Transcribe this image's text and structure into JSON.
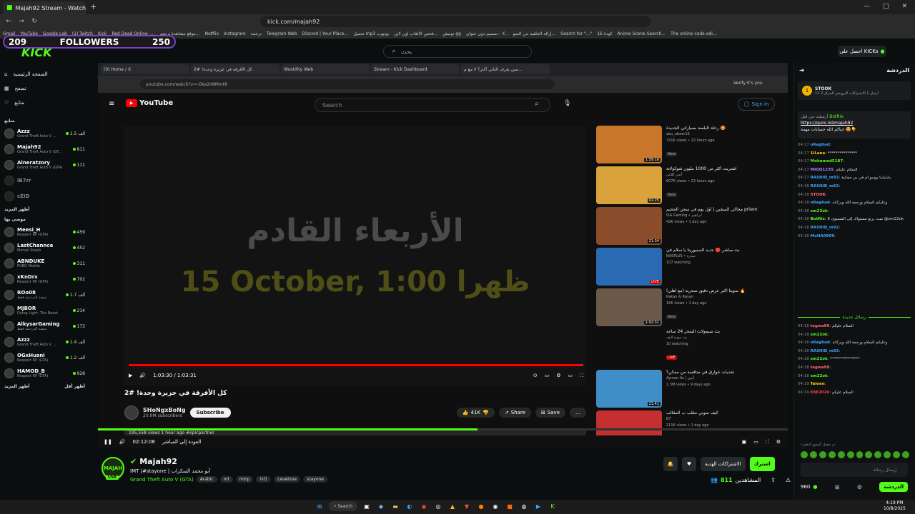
{
  "browser": {
    "tab_title": "Majah92 Stream - Watch Liv",
    "url": "kick.com/majah92",
    "bookmarks": [
      "Gmail",
      "YouTube",
      "Google Lab",
      "(1) Twitch",
      "Kick",
      "Red Dead Online -...",
      "موقع مشاهدة و تحم...",
      "Netflix",
      "Instagram",
      "ترجمة",
      "Telegram Web",
      "Discord | Your Place...",
      "تحميل mp3 يوتيوب",
      "فحص الالعاب اون لاين...",
      "توتيش gg",
      "تصميم دون عنوان - Y...",
      "إزالة الخلفية من الصو...",
      "Search for \"...\"",
      "كودة 16",
      "Anime Scene Search...",
      "The online code edi..."
    ]
  },
  "overlay": {
    "followers_left": "209",
    "followers_label": "FOLLOWERS",
    "followers_right": "250"
  },
  "kick": {
    "logo": "KICK",
    "search_placeholder": "بحث",
    "get_kicks": "احصل على KICKs",
    "nav": [
      "الصفحة الرئيسية",
      "تصفح",
      "متابع"
    ],
    "following_head": "متابع",
    "following": [
      {
        "name": "Azzz",
        "game": "Grand Theft Auto V ...",
        "viewers": "1.5 ألف"
      },
      {
        "name": "Majah92",
        "game": "Grand Theft Auto V (GT...",
        "viewers": "811"
      },
      {
        "name": "Alneratzory",
        "game": "Grand Theft Auto V (GTA)",
        "viewers": "111"
      },
      {
        "name": "lB7rr",
        "game": "",
        "viewers": ""
      },
      {
        "name": "cEID",
        "game": "",
        "viewers": ""
      }
    ],
    "show_more_1": "أظهر المزيد",
    "recommended_head": "موصى بها",
    "recommended": [
      {
        "name": "Meesi_H",
        "game": "Respect RP (GTA)",
        "viewers": "459"
      },
      {
        "name": "LastChannce",
        "game": "Marvel Rivals",
        "viewers": "452"
      },
      {
        "name": "ABNDUKE",
        "game": "PUBG Mobile",
        "viewers": "311"
      },
      {
        "name": "xKnDrx",
        "game": "Respect RP (GTA)",
        "viewers": "702"
      },
      {
        "name": "ROo08",
        "game": "منصة الدردشة فقط",
        "viewers": "1.7 ألف"
      },
      {
        "name": "MJBOR",
        "game": "Dying Light: The Beast",
        "viewers": "214"
      },
      {
        "name": "AlkysarGaming",
        "game": "منصة الدردشة فقط",
        "viewers": "173"
      },
      {
        "name": "Azzz",
        "game": "Grand Theft Auto V ...",
        "viewers": "1.4 ألف"
      },
      {
        "name": "OGxHusni",
        "game": "Respect RP (GTA)",
        "viewers": "1.2 ألف"
      },
      {
        "name": "HAMOD_B",
        "game": "Respect RP (GTA)",
        "viewers": "928"
      }
    ],
    "show_more_2": "أظهر المزيد",
    "show_less": "أظهر أقل"
  },
  "inner_browser": {
    "tabs": [
      "(9) Home / X",
      "كل الأفرقة في جزيرة وحدة! #2",
      "Wootility Web",
      "Stream - Kick Dashboard",
      "مين يعرف التاني أكثر؟ لا مع م..."
    ],
    "url": "youtube.com/watch?v=-Oke2IWMmt8",
    "verify": "Verify it's you"
  },
  "youtube": {
    "logo": "YouTube",
    "search_placeholder": "Search",
    "signin": "Sign in",
    "video_line1": "الأربعاء القادم",
    "video_line2": "15 October, 1:00 ظهرا",
    "time": "1:03:30 / 1:03:31",
    "progress_fraction": 0.997,
    "title": "كل الأفرقة في جزيرة وحدة! #2",
    "channel": "SHoNgxBoNg",
    "subs": "20.9M subscribers",
    "subscribe": "Subscribe",
    "likes": "41K",
    "share": "Share",
    "save": "Save",
    "desc": "195,558 views  1 hour ago  #epicpartner",
    "recs": [
      {
        "title": "رحلة البلسة بسياراتي الجديدة 🤩",
        "channel": "abu_abeer16",
        "meta": "741K views • 22 hours ago",
        "badge": "New",
        "dur": "1:59:16",
        "color": "#c9762b"
      },
      {
        "title": "اشتريت أكثر من 1000 مليون شوكولاتة",
        "channel": "أنس كلاش",
        "meta": "607K views • 23 hours ago",
        "badge": "New",
        "dur": "41:25",
        "color": "#d9a23a"
      },
      {
        "title": "محاكي السجين | أول يوم في سجن الجحيم prison",
        "channel": "iSA Gaming • ابراهيم",
        "meta": "42K views • 1 day ago",
        "badge": "",
        "dur": "21:34",
        "color": "#8a4c2a"
      },
      {
        "title": "بث مباشر 🔴 جديد السنيوريتا يا سلام في",
        "channel": "NASPLUS • سدرة",
        "meta": "107 watching",
        "badge": "",
        "dur": "LIVE",
        "color": "#2a6ab3"
      },
      {
        "title": "سويتا اكبر عرض دقيق سحرية (مع أهلي) 🔥",
        "channel": "Rakan & Rayan",
        "meta": "16K views • 1 day ago",
        "badge": "New",
        "dur": "1:02:31",
        "color": "#6b5a4a"
      },
      {
        "title": "بث سيمولات السحر 24 ساعة",
        "channel": "بث موزة لايف",
        "meta": "10 watching",
        "badge": "LIVE",
        "dur": "",
        "color": "#0f0f0f"
      },
      {
        "title": "تحديات خوارق في منافسة من ممكن؟",
        "channel": "Ayman Az | أيمن",
        "meta": "1.3M views • 9 days ago",
        "badge": "",
        "dur": "21:41",
        "color": "#3f8ec7"
      },
      {
        "title": "كيف صوبي مقلب ب المقالب",
        "channel": "B7",
        "meta": "211K views • 1 day ago",
        "badge": "",
        "dur": "",
        "color": "#c42f2f"
      }
    ]
  },
  "player": {
    "time": "02:12:06",
    "live_label": "العودة إلى المباشر",
    "progress_fraction": 0.55
  },
  "stream": {
    "avatar_text": "MAJAH",
    "live": "LIVE",
    "name": "Majah92",
    "title": "IMT |#stayone | أبو محمد السكراب",
    "game": "Grand Theft Auto V (GTA)",
    "tags": [
      "Arabic",
      "mt",
      "mtrp",
      "lvl1",
      "Levelone",
      "stayone"
    ],
    "subscribe": "اشترك",
    "gifts": "الاشتراكات الهدية",
    "viewers_label": "المشاهدين",
    "viewers": "811"
  },
  "chat": {
    "title": "الدردشة",
    "pinned_user": "STOOK",
    "pinned_text": "أرسل 1 الاشتراكات الترويجي المركز 2",
    "pinned_count": "11",
    "pin_by": "أرسلت من قبل",
    "pin_user": "BotRix",
    "pin_link": "https://guns.lol/majah92",
    "pin_text": "حياكم الله حسابات مهمة 🤩👇",
    "messages": [
      {
        "time": "04:17",
        "user": "oRaghad",
        "color": "#3ea6ff",
        "text": ""
      },
      {
        "time": "04:17",
        "user": "1lLana",
        "color": "#ffcc00",
        "text": "***************"
      },
      {
        "time": "04:17",
        "user": "Mohamed5187",
        "color": "#53fc18",
        "text": ""
      },
      {
        "time": "04:17",
        "user": "MIQQ1235",
        "color": "#b57bff",
        "text": "السلام عليكم"
      },
      {
        "time": "04:17",
        "user": "RASHID_m92",
        "color": "#3ea6ff",
        "text": "ياشبابنا يوسو ام في بي مجانية"
      },
      {
        "time": "04:18",
        "user": "RASHID_m92",
        "color": "#3ea6ff",
        "text": ""
      },
      {
        "time": "04:18",
        "user": "STOOK",
        "color": "#ff6b6b",
        "text": ""
      },
      {
        "time": "04:18",
        "user": "oRaghad",
        "color": "#3ea6ff",
        "text": "وعليكم السلام ورحمة الله وبركاته"
      },
      {
        "time": "04:18",
        "user": "sm22ok",
        "color": "#53fc18",
        "text": ""
      },
      {
        "time": "04:18",
        "user": "BotRix",
        "color": "#53fc18",
        "text": "تمت برنع مستواك إلى المستوى 6 @sm22ok"
      },
      {
        "time": "04:18",
        "user": "RASHID_m92",
        "color": "#3ea6ff",
        "text": ""
      },
      {
        "time": "04:18",
        "user": "MoHA0909",
        "color": "#3ea6ff",
        "text": ""
      }
    ],
    "new_messages": "رسائل جديدة",
    "messages2": [
      {
        "time": "04:18",
        "user": "tagwa99",
        "color": "#ff6b6b",
        "text": "السلام عليكم"
      },
      {
        "time": "04:18",
        "user": "sm22ok",
        "color": "#53fc18",
        "text": ""
      },
      {
        "time": "04:18",
        "user": "oRaghad",
        "color": "#3ea6ff",
        "text": "وعليكم السلام ورحمة الله وبركاته"
      },
      {
        "time": "04:18",
        "user": "RASHID_m92",
        "color": "#3ea6ff",
        "text": ""
      },
      {
        "time": "04:18",
        "user": "sm22ok",
        "color": "#53fc18",
        "text": "***************"
      },
      {
        "time": "04:18",
        "user": "tagwa99",
        "color": "#ff6b6b",
        "text": ""
      },
      {
        "time": "04:18",
        "user": "sm22ok",
        "color": "#53fc18",
        "text": ""
      },
      {
        "time": "04:19",
        "user": "Taleen",
        "color": "#ffcc00",
        "text": ""
      },
      {
        "time": "04:19",
        "user": "E8E2026",
        "color": "#ff4444",
        "text": "السلام عليكم"
      }
    ],
    "mode_notice": "تم تفعيل الوضع البطيء",
    "input_placeholder": "إرسال رسالة",
    "kicks": "960",
    "chat_button": "الدردشة"
  },
  "taskbar": {
    "search": "Search",
    "time": "4:19 PM",
    "date": "10/8/2025"
  }
}
